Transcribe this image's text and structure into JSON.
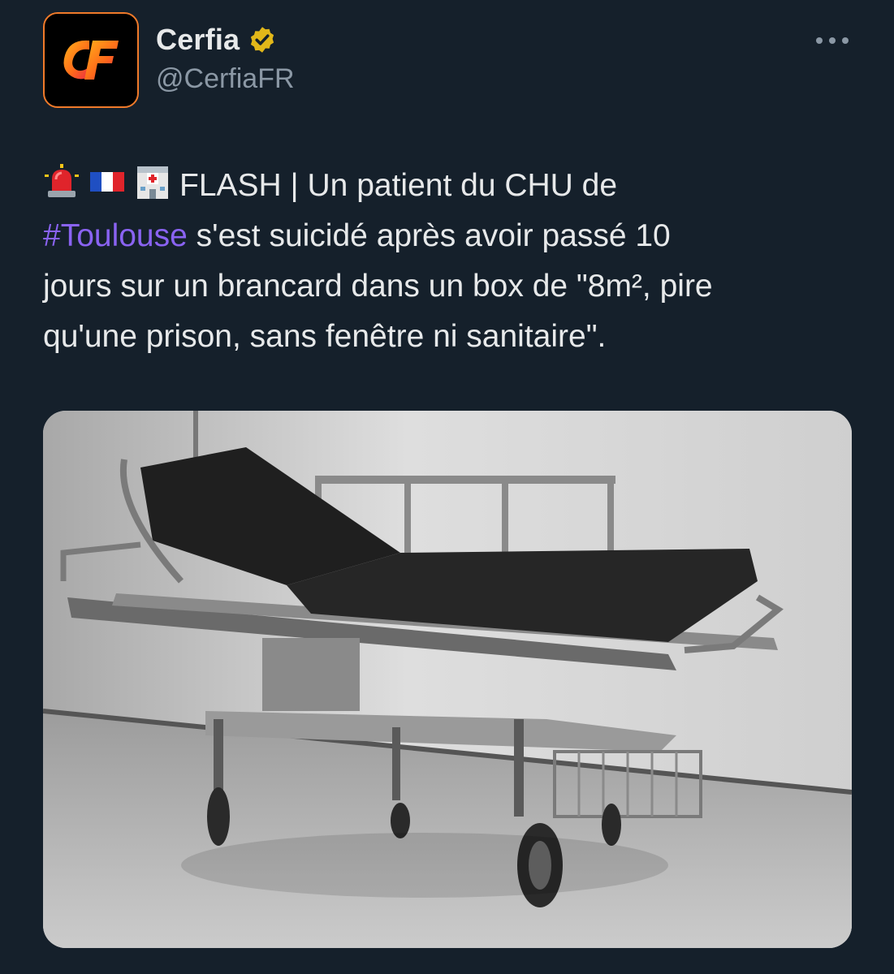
{
  "author": {
    "display_name": "Cerfia",
    "handle": "@CerfiaFR",
    "avatar_text": "CF",
    "verified": true,
    "badge_color": "#e2b719"
  },
  "icons": {
    "more": "more-options-icon",
    "verified": "verified-badge-icon",
    "siren": "rotating-light-icon",
    "flag": "france-flag-icon",
    "hospital": "hospital-icon"
  },
  "tweet": {
    "line1": "FLASH | Un patient du CHU de",
    "hashtag": "#Toulouse",
    "line2_rest": " s'est suicidé après avoir passé 10",
    "line3": "jours sur un brancard dans un box de \"8m², pire",
    "line4": "qu'une prison, sans fenêtre ni sanitaire\"."
  },
  "colors": {
    "background": "#15202b",
    "text": "#e7e9ea",
    "secondary": "#8b98a5",
    "hashtag": "#8a63f2",
    "avatar_accent": "#f07a2a"
  }
}
